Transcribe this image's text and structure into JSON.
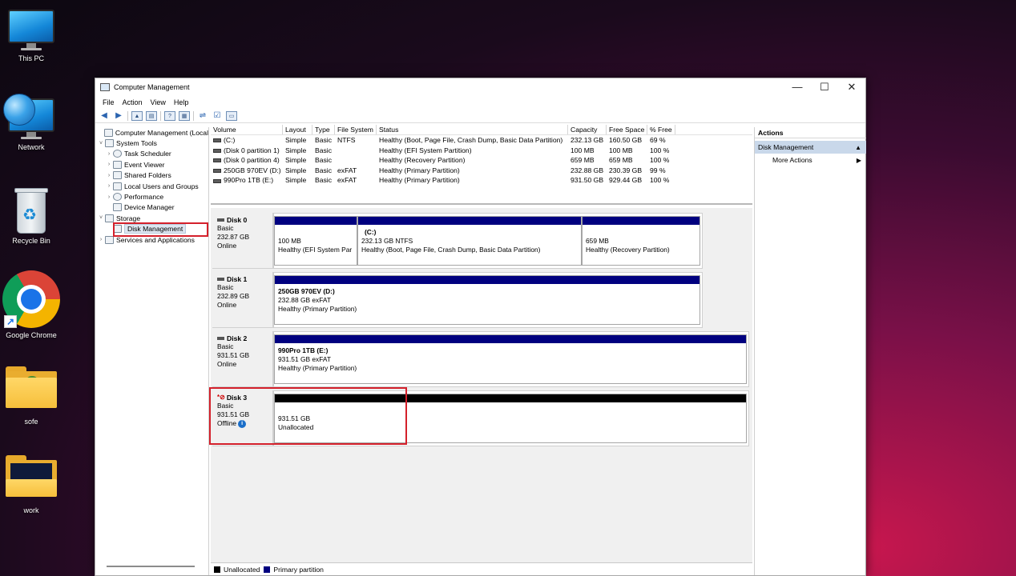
{
  "desktop": {
    "icons": [
      {
        "label": "This PC"
      },
      {
        "label": "Network"
      },
      {
        "label": "Recycle Bin"
      },
      {
        "label": "Google Chrome"
      },
      {
        "label": "sofe"
      },
      {
        "label": "work"
      }
    ]
  },
  "window": {
    "title": "Computer Management",
    "controls": {
      "minimize": "—",
      "maximize": "☐",
      "close": "✕"
    },
    "menu": [
      "File",
      "Action",
      "View",
      "Help"
    ]
  },
  "tree": {
    "items": [
      {
        "label": "Computer Management (Local",
        "chev": ""
      },
      {
        "label": "System Tools",
        "chev": "˅"
      },
      {
        "label": "Task Scheduler",
        "chev": "›"
      },
      {
        "label": "Event Viewer",
        "chev": "›"
      },
      {
        "label": "Shared Folders",
        "chev": "›"
      },
      {
        "label": "Local Users and Groups",
        "chev": "›"
      },
      {
        "label": "Performance",
        "chev": "›"
      },
      {
        "label": "Device Manager",
        "chev": ""
      },
      {
        "label": "Storage",
        "chev": "˅"
      },
      {
        "label": "Disk Management",
        "chev": ""
      },
      {
        "label": "Services and Applications",
        "chev": "›"
      }
    ]
  },
  "volumes": {
    "columns": [
      "Volume",
      "Layout",
      "Type",
      "File System",
      "Status",
      "Capacity",
      "Free Space",
      "% Free"
    ],
    "rows": [
      [
        "(C:)",
        "Simple",
        "Basic",
        "NTFS",
        "Healthy (Boot, Page File, Crash Dump, Basic Data Partition)",
        "232.13 GB",
        "160.50 GB",
        "69 %"
      ],
      [
        "(Disk 0 partition 1)",
        "Simple",
        "Basic",
        "",
        "Healthy (EFI System Partition)",
        "100 MB",
        "100 MB",
        "100 %"
      ],
      [
        "(Disk 0 partition 4)",
        "Simple",
        "Basic",
        "",
        "Healthy (Recovery Partition)",
        "659 MB",
        "659 MB",
        "100 %"
      ],
      [
        "250GB 970EV (D:)",
        "Simple",
        "Basic",
        "exFAT",
        "Healthy (Primary Partition)",
        "232.88 GB",
        "230.39 GB",
        "99 %"
      ],
      [
        "990Pro 1TB (E:)",
        "Simple",
        "Basic",
        "exFAT",
        "Healthy (Primary Partition)",
        "931.50 GB",
        "929.44 GB",
        "100 %"
      ]
    ]
  },
  "disks": [
    {
      "name": "Disk 0",
      "type": "Basic",
      "size": "232.87 GB",
      "status": "Online",
      "partitions": [
        {
          "title": "",
          "line1": "100 MB",
          "line2": "Healthy (EFI System Par"
        },
        {
          "title": "(C:)",
          "line1": "232.13 GB NTFS",
          "line2": "Healthy (Boot, Page File, Crash Dump, Basic Data Partition)"
        },
        {
          "title": "",
          "line1": "659 MB",
          "line2": "Healthy (Recovery Partition)"
        }
      ]
    },
    {
      "name": "Disk 1",
      "type": "Basic",
      "size": "232.89 GB",
      "status": "Online",
      "partitions": [
        {
          "title": "250GB 970EV  (D:)",
          "line1": "232.88 GB exFAT",
          "line2": "Healthy (Primary Partition)"
        }
      ]
    },
    {
      "name": "Disk 2",
      "type": "Basic",
      "size": "931.51 GB",
      "status": "Online",
      "partitions": [
        {
          "title": "990Pro 1TB  (E:)",
          "line1": "931.51 GB exFAT",
          "line2": "Healthy (Primary Partition)"
        }
      ]
    },
    {
      "name": "Disk 3",
      "type": "Basic",
      "size": "931.51 GB",
      "status": "Offline",
      "partitions": [
        {
          "title": "",
          "line1": "931.51 GB",
          "line2": "Unallocated"
        }
      ]
    }
  ],
  "legend": [
    {
      "label": "Unallocated",
      "color": "#000000"
    },
    {
      "label": "Primary partition",
      "color": "#00007f"
    }
  ],
  "actions": {
    "header": "Actions",
    "section": "Disk Management",
    "items": [
      "More Actions"
    ]
  },
  "colors": {
    "primary_partition": "#00007f",
    "unallocated": "#000000",
    "highlight": "#d4202b",
    "selection": "#c9d8ea"
  }
}
